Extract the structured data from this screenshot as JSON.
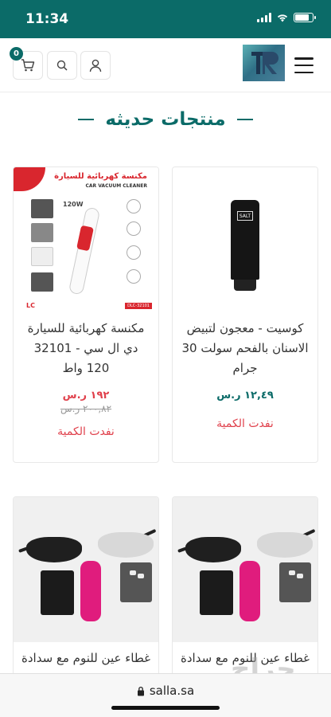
{
  "status_bar": {
    "time": "11:34",
    "battery_level": 0.8
  },
  "header": {
    "cart_count": "0",
    "logo_text": "TR"
  },
  "section": {
    "title": "منتجات حديثه"
  },
  "products": [
    {
      "name": "كوسيت - معجون لتبيض الاسنان بالفحم سولت 30 جرام",
      "price": "١٢,٤٩ ر.س",
      "old_price": "",
      "status": "نفدت الكمية",
      "image_label": "SALT"
    },
    {
      "name": "مكنسة كهربائية للسيارة دي ال سي - 32101 120 واط",
      "price": "١٩٢ ر.س",
      "old_price": "٢٠٠,٨٢ ر.س",
      "status": "نفدت الكمية",
      "image_text": {
        "title_ar": "مكنسة كهربائية للسيارة",
        "title_en": "CAR VACUUM CLEANER",
        "power": "120W",
        "brand": "LC",
        "model": "DLC-32101"
      }
    },
    {
      "name": "غطاء عين للنوم مع سدادة"
    },
    {
      "name": "غطاء عين للنوم مع سدادة"
    }
  ],
  "browser": {
    "url": "salla.sa"
  },
  "watermark": "حراج"
}
